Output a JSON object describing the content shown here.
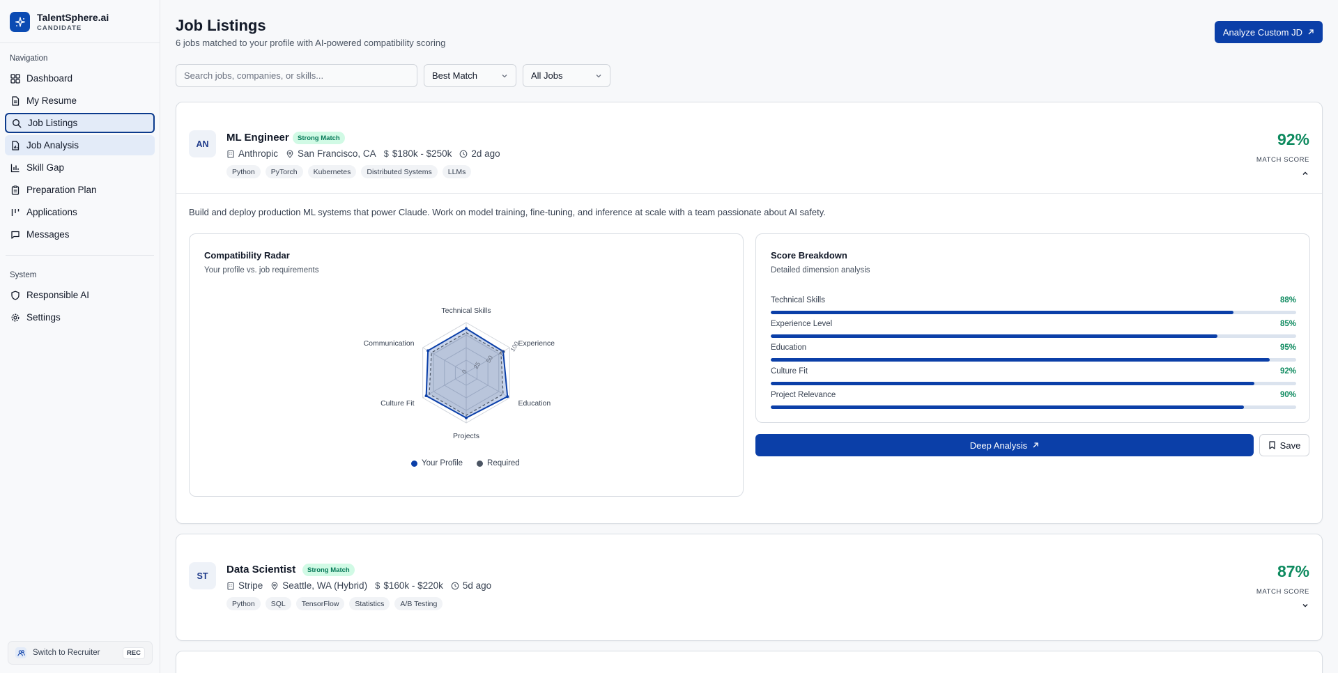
{
  "brand": {
    "name": "TalentSphere.ai",
    "role": "CANDIDATE"
  },
  "sidebar": {
    "nav_heading": "Navigation",
    "items": [
      {
        "label": "Dashboard",
        "icon": "grid-icon"
      },
      {
        "label": "My Resume",
        "icon": "document-icon"
      },
      {
        "label": "Job Listings",
        "icon": "search-icon"
      },
      {
        "label": "Job Analysis",
        "icon": "file-chart-icon"
      },
      {
        "label": "Skill Gap",
        "icon": "bar-chart-icon"
      },
      {
        "label": "Preparation Plan",
        "icon": "clipboard-icon"
      },
      {
        "label": "Applications",
        "icon": "columns-icon"
      },
      {
        "label": "Messages",
        "icon": "message-icon"
      }
    ],
    "system_heading": "System",
    "system_items": [
      {
        "label": "Responsible AI",
        "icon": "shield-icon"
      },
      {
        "label": "Settings",
        "icon": "gear-icon"
      }
    ],
    "switch_label": "Switch to Recruiter",
    "switch_badge": "REC"
  },
  "header": {
    "title": "Job Listings",
    "subtitle": "6 jobs matched to your profile with AI-powered compatibility scoring",
    "analyze_label": "Analyze Custom JD"
  },
  "filters": {
    "search_placeholder": "Search jobs, companies, or skills...",
    "sort_value": "Best Match",
    "type_value": "All Jobs"
  },
  "jobs": [
    {
      "initials": "AN",
      "title": "ML Engineer",
      "badge": "Strong Match",
      "company": "Anthropic",
      "location": "San Francisco, CA",
      "salary": "$180k - $250k",
      "posted": "2d ago",
      "tags": [
        "Python",
        "PyTorch",
        "Kubernetes",
        "Distributed Systems",
        "LLMs"
      ],
      "score": "92%",
      "score_label": "MATCH SCORE",
      "description": "Build and deploy production ML systems that power Claude. Work on model training, fine-tuning, and inference at scale with a team passionate about AI safety.",
      "radar": {
        "title": "Compatibility Radar",
        "subtitle": "Your profile vs. job requirements",
        "axes": [
          "Technical Skills",
          "Experience",
          "Education",
          "Projects",
          "Culture Fit",
          "Communication"
        ],
        "ticks": [
          "0",
          "25",
          "50",
          "75",
          "100"
        ],
        "profile": [
          88,
          85,
          95,
          90,
          92,
          88
        ],
        "required": [
          80,
          80,
          85,
          85,
          85,
          80
        ],
        "legend_profile": "Your Profile",
        "legend_required": "Required",
        "color_profile": "#0b3fa8",
        "color_required": "#4b5563"
      },
      "breakdown": {
        "title": "Score Breakdown",
        "subtitle": "Detailed dimension analysis",
        "rows": [
          {
            "label": "Technical Skills",
            "value": "88%",
            "pct": 88
          },
          {
            "label": "Experience Level",
            "value": "85%",
            "pct": 85
          },
          {
            "label": "Education",
            "value": "95%",
            "pct": 95
          },
          {
            "label": "Culture Fit",
            "value": "92%",
            "pct": 92
          },
          {
            "label": "Project Relevance",
            "value": "90%",
            "pct": 90
          }
        ]
      },
      "deep_label": "Deep Analysis",
      "save_label": "Save"
    },
    {
      "initials": "ST",
      "title": "Data Scientist",
      "badge": "Strong Match",
      "company": "Stripe",
      "location": "Seattle, WA (Hybrid)",
      "salary": "$160k - $220k",
      "posted": "5d ago",
      "tags": [
        "Python",
        "SQL",
        "TensorFlow",
        "Statistics",
        "A/B Testing"
      ],
      "score": "87%",
      "score_label": "MATCH SCORE"
    }
  ],
  "colors": {
    "accent": "#0b3fa8",
    "success": "#0e8a5f",
    "badge_bg": "#d1fae5"
  }
}
